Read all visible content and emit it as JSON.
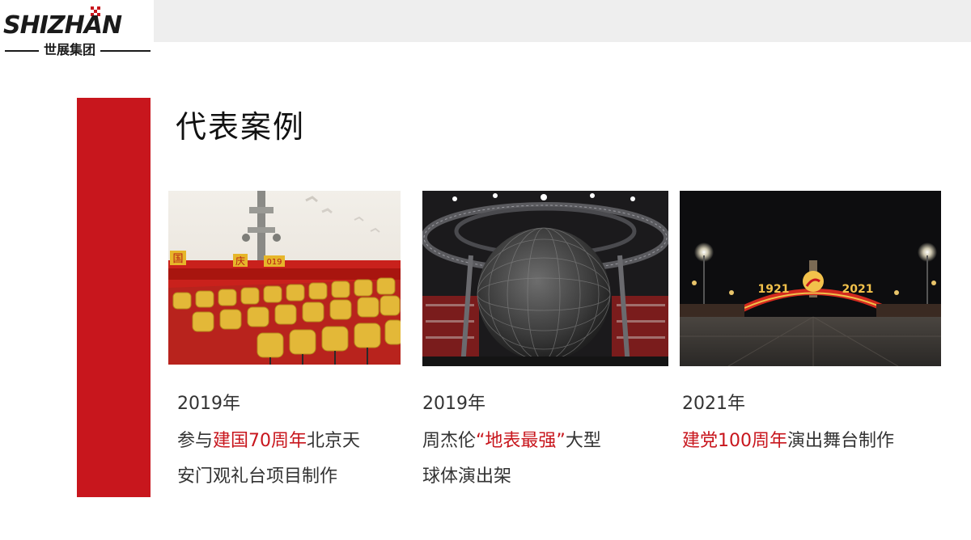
{
  "brand": {
    "logo_text": "SHIZHAN",
    "logo_subtitle": "世展集团"
  },
  "title": "代表案例",
  "colors": {
    "accent": "#c8161d",
    "topbar": "#eeeeee",
    "text": "#333333"
  },
  "cases": [
    {
      "year": "2019年",
      "desc_before": "参与",
      "desc_highlight": "建国70周年",
      "desc_after_1": "北京天",
      "desc_line2": "安门观礼台项目制作",
      "photo_signage": [
        "国",
        "庆",
        "019"
      ]
    },
    {
      "year": "2019年",
      "desc_before": "周杰伦",
      "desc_highlight": "“地表最强”",
      "desc_after_1": "大型",
      "desc_line2": "球体演出架"
    },
    {
      "year": "2021年",
      "desc_highlight": "建党100周年",
      "desc_after_1": "演出舞台制作",
      "photo_signage": [
        "1921",
        "2021"
      ]
    }
  ]
}
